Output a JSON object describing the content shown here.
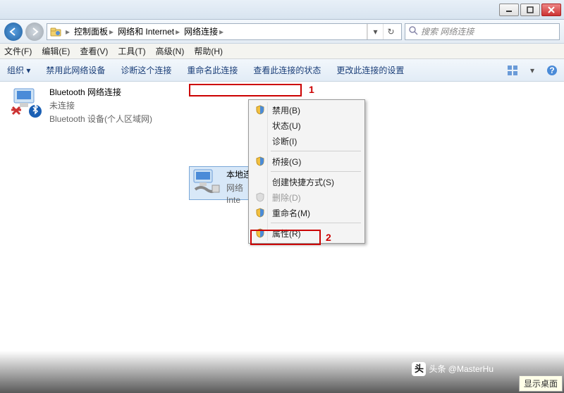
{
  "breadcrumb": {
    "root_arrow": "▸",
    "p1": "控制面板",
    "p2": "网络和 Internet",
    "p3": "网络连接"
  },
  "search": {
    "placeholder": "搜索 网络连接"
  },
  "menu": {
    "file": "文件(F)",
    "edit": "编辑(E)",
    "view": "查看(V)",
    "tools": "工具(T)",
    "advanced": "高级(N)",
    "help": "帮助(H)"
  },
  "toolbar": {
    "organize": "组织 ▾",
    "disable": "禁用此网络设备",
    "diagnose": "诊断这个连接",
    "rename": "重命名此连接",
    "status": "查看此连接的状态",
    "change": "更改此连接的设置"
  },
  "bluetooth": {
    "name": "Bluetooth 网络连接",
    "status": "未连接",
    "device": "Bluetooth 设备(个人区域网)"
  },
  "local": {
    "name": "本地连接",
    "line2": "网络",
    "line3": "Inte"
  },
  "annot": {
    "one": "1",
    "two": "2"
  },
  "ctx": {
    "disable": "禁用(B)",
    "status": "状态(U)",
    "diagnose": "诊断(I)",
    "bridge": "桥接(G)",
    "shortcut": "创建快捷方式(S)",
    "delete": "删除(D)",
    "rename": "重命名(M)",
    "properties": "属性(R)"
  },
  "watermark": "头条 @MasterHu",
  "desk": "显示桌面"
}
